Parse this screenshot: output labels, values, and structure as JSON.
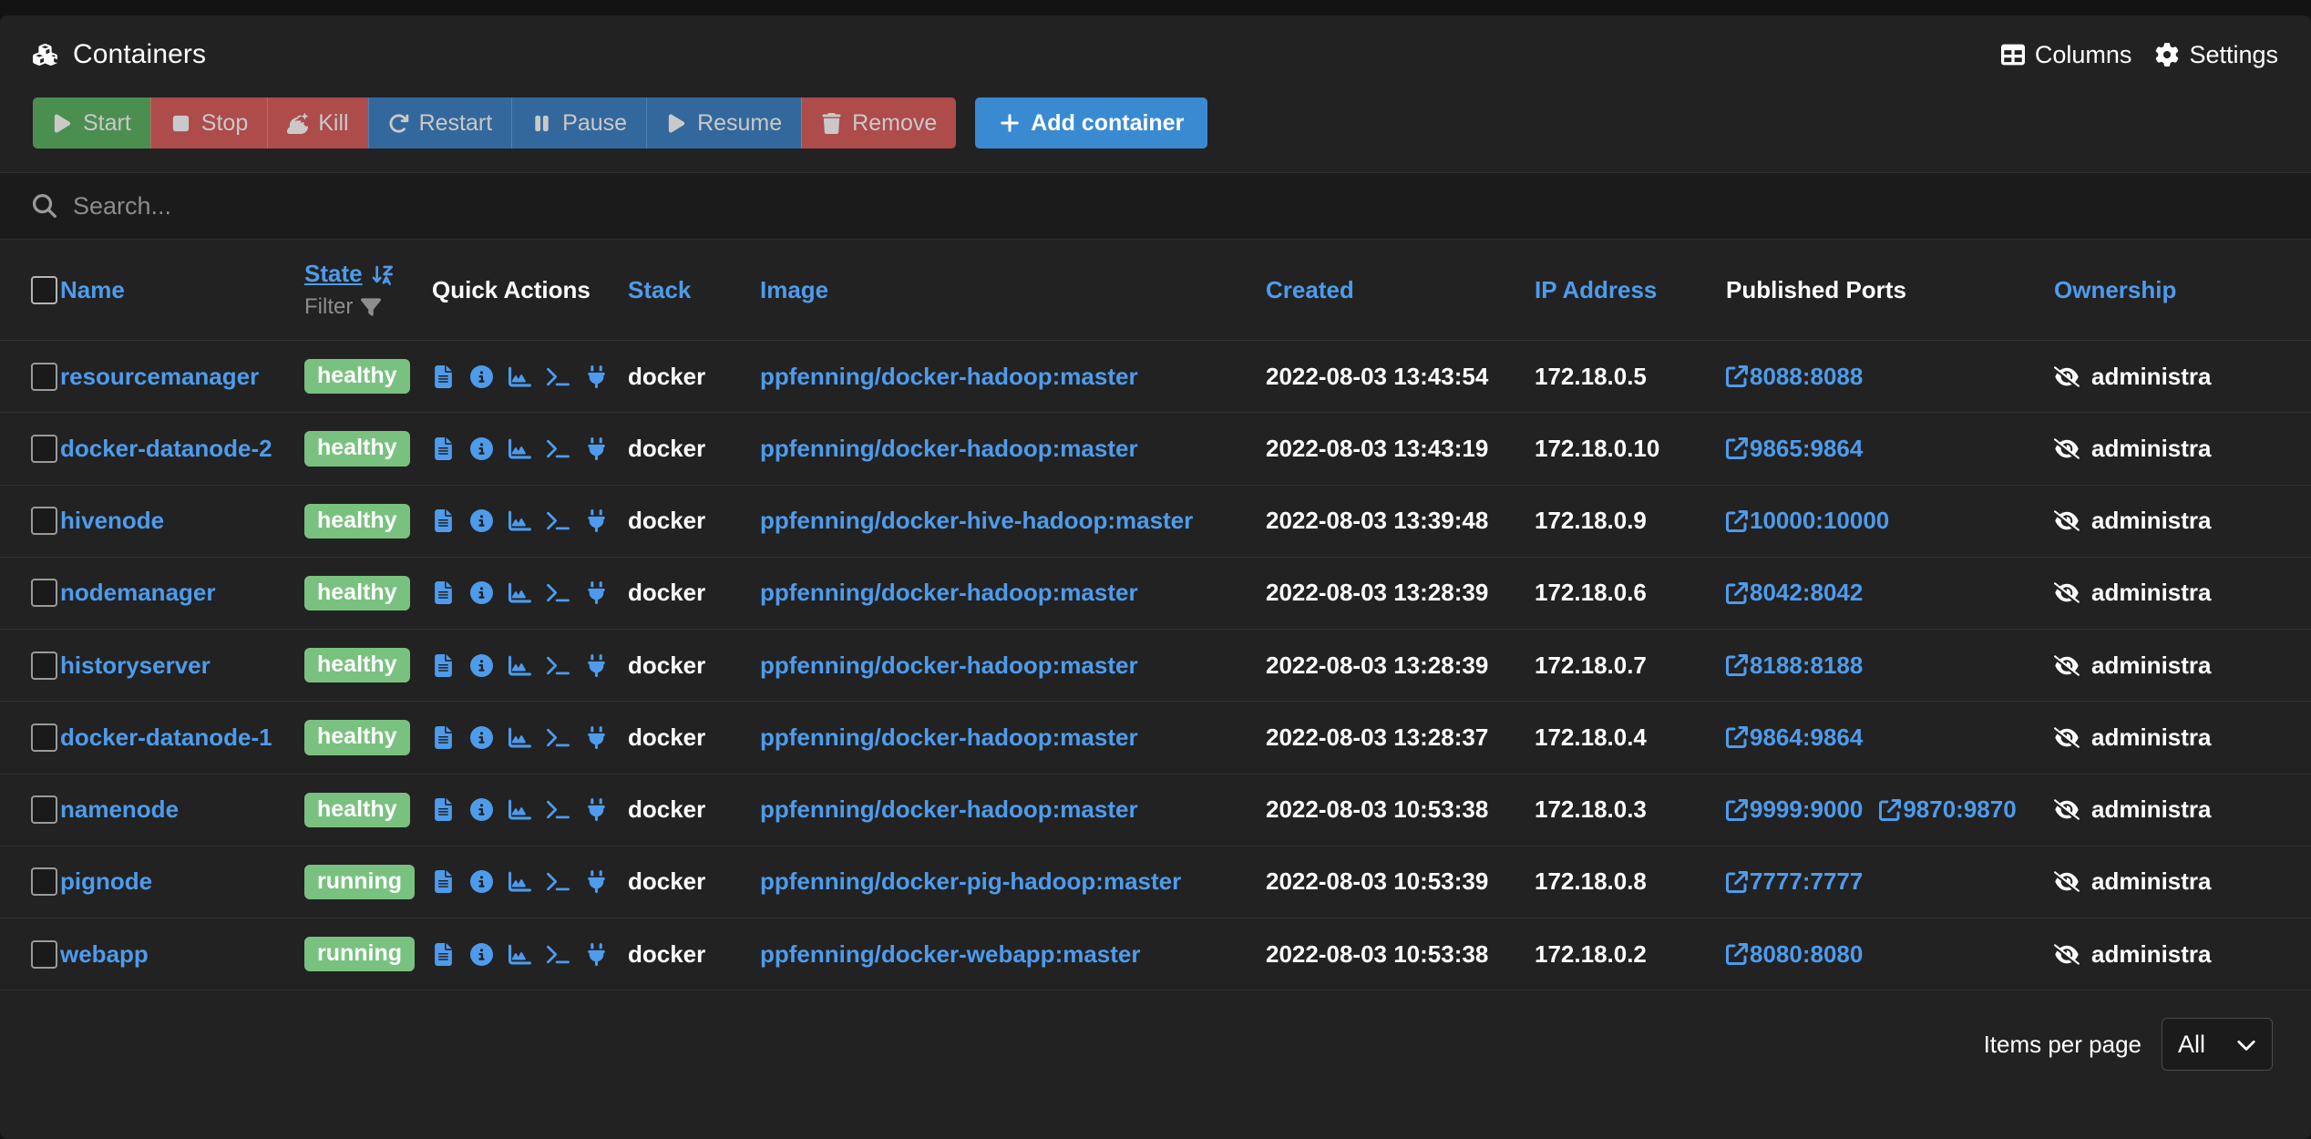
{
  "header": {
    "title": "Containers",
    "title_icon": "cubes-icon",
    "actions": [
      {
        "label": "Columns",
        "icon": "table-columns-icon"
      },
      {
        "label": "Settings",
        "icon": "gear-icon"
      }
    ]
  },
  "toolbar": {
    "buttons": [
      {
        "label": "Start",
        "icon": "play-icon",
        "color": "#4a8f50"
      },
      {
        "label": "Stop",
        "icon": "stop-icon",
        "color": "#ae4b4b"
      },
      {
        "label": "Kill",
        "icon": "bomb-icon",
        "color": "#ae4b4b"
      },
      {
        "label": "Restart",
        "icon": "refresh-icon",
        "color": "#33689c"
      },
      {
        "label": "Pause",
        "icon": "pause-icon",
        "color": "#33689c"
      },
      {
        "label": "Resume",
        "icon": "play-icon",
        "color": "#33689c"
      },
      {
        "label": "Remove",
        "icon": "trash-icon",
        "color": "#ae4b4b"
      }
    ],
    "add_label": "Add container",
    "add_icon": "plus-icon",
    "add_color": "#3a8ad2"
  },
  "search": {
    "value": "",
    "placeholder": "Search...",
    "icon": "search-icon"
  },
  "table": {
    "columns": [
      {
        "key": "check",
        "label": "",
        "sortable": false,
        "type": "checkbox"
      },
      {
        "key": "name",
        "label": "Name",
        "sortable": true,
        "active": false
      },
      {
        "key": "state",
        "label": "State",
        "sortable": true,
        "active": true,
        "sort_icon": "sort-down-az-icon",
        "filter_label": "Filter",
        "filter_icon": "funnel-icon"
      },
      {
        "key": "actions",
        "label": "Quick Actions",
        "sortable": false
      },
      {
        "key": "stack",
        "label": "Stack",
        "sortable": true,
        "active": false
      },
      {
        "key": "image",
        "label": "Image",
        "sortable": true,
        "active": false
      },
      {
        "key": "created",
        "label": "Created",
        "sortable": true,
        "active": false
      },
      {
        "key": "ip",
        "label": "IP Address",
        "sortable": true,
        "active": false
      },
      {
        "key": "ports",
        "label": "Published Ports",
        "sortable": false
      },
      {
        "key": "own",
        "label": "Ownership",
        "sortable": true,
        "active": false
      }
    ],
    "quick_action_icons": [
      "file-lines-icon",
      "info-circle-icon",
      "chart-area-icon",
      "terminal-icon",
      "plug-icon"
    ],
    "rows": [
      {
        "name": "resourcemanager",
        "state": "healthy",
        "stack": "docker",
        "image": "ppfenning/docker-hadoop:master",
        "created": "2022-08-03 13:43:54",
        "ip": "172.18.0.5",
        "ports": [
          "8088:8088"
        ],
        "ownership": "administra"
      },
      {
        "name": "docker-datanode-2",
        "state": "healthy",
        "stack": "docker",
        "image": "ppfenning/docker-hadoop:master",
        "created": "2022-08-03 13:43:19",
        "ip": "172.18.0.10",
        "ports": [
          "9865:9864"
        ],
        "ownership": "administra"
      },
      {
        "name": "hivenode",
        "state": "healthy",
        "stack": "docker",
        "image": "ppfenning/docker-hive-hadoop:master",
        "created": "2022-08-03 13:39:48",
        "ip": "172.18.0.9",
        "ports": [
          "10000:10000"
        ],
        "ownership": "administra"
      },
      {
        "name": "nodemanager",
        "state": "healthy",
        "stack": "docker",
        "image": "ppfenning/docker-hadoop:master",
        "created": "2022-08-03 13:28:39",
        "ip": "172.18.0.6",
        "ports": [
          "8042:8042"
        ],
        "ownership": "administra"
      },
      {
        "name": "historyserver",
        "state": "healthy",
        "stack": "docker",
        "image": "ppfenning/docker-hadoop:master",
        "created": "2022-08-03 13:28:39",
        "ip": "172.18.0.7",
        "ports": [
          "8188:8188"
        ],
        "ownership": "administra"
      },
      {
        "name": "docker-datanode-1",
        "state": "healthy",
        "stack": "docker",
        "image": "ppfenning/docker-hadoop:master",
        "created": "2022-08-03 13:28:37",
        "ip": "172.18.0.4",
        "ports": [
          "9864:9864"
        ],
        "ownership": "administra"
      },
      {
        "name": "namenode",
        "state": "healthy",
        "stack": "docker",
        "image": "ppfenning/docker-hadoop:master",
        "created": "2022-08-03 10:53:38",
        "ip": "172.18.0.3",
        "ports": [
          "9999:9000",
          "9870:9870"
        ],
        "ownership": "administra"
      },
      {
        "name": "pignode",
        "state": "running",
        "stack": "docker",
        "image": "ppfenning/docker-pig-hadoop:master",
        "created": "2022-08-03 10:53:39",
        "ip": "172.18.0.8",
        "ports": [
          "7777:7777"
        ],
        "ownership": "administra"
      },
      {
        "name": "webapp",
        "state": "running",
        "stack": "docker",
        "image": "ppfenning/docker-webapp:master",
        "created": "2022-08-03 10:53:38",
        "ip": "172.18.0.2",
        "ports": [
          "8080:8080"
        ],
        "ownership": "administra"
      }
    ]
  },
  "footer": {
    "items_per_page_label": "Items per page",
    "items_per_page_value": "All",
    "chevron_icon": "chevron-down-icon"
  },
  "colors": {
    "page_bg": "#131313",
    "card_bg": "#222222",
    "link": "#4e9bec",
    "badge_green": "#79c17f",
    "btn_green": "#4a8f50",
    "btn_red": "#ae4b4b",
    "btn_blue": "#33689c",
    "accent_blue": "#3a8ad2"
  }
}
